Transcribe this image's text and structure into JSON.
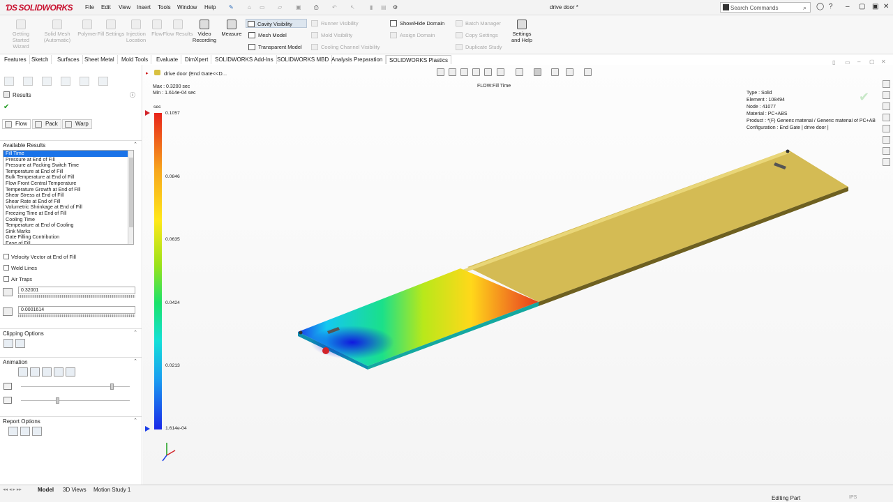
{
  "app": {
    "brand": "SOLIDWORKS",
    "document_title": "drive door *"
  },
  "menu": [
    "File",
    "Edit",
    "View",
    "Insert",
    "Tools",
    "Window",
    "Help"
  ],
  "search": {
    "placeholder": "Search Commands"
  },
  "ribbon": {
    "big_buttons": [
      {
        "label": "Getting Started Wizard",
        "enabled": false
      },
      {
        "label": "Solid Mesh (Automatic)",
        "enabled": false
      },
      {
        "label": "Polymer",
        "enabled": false
      },
      {
        "label": "Fill Settings",
        "enabled": false
      },
      {
        "label": "Injection Location",
        "enabled": false
      },
      {
        "label": "Flow",
        "enabled": false
      },
      {
        "label": "Flow Results",
        "enabled": false
      },
      {
        "label": "Video Recording",
        "enabled": true
      },
      {
        "label": "Measure",
        "enabled": true
      }
    ],
    "col1": [
      "Cavity Visibility",
      "Mesh Model",
      "Transparent Model"
    ],
    "col2": [
      "Runner Visibility",
      "Mold Visibility",
      "Cooling Channel Visibility"
    ],
    "col3": [
      "Show/Hide Domain",
      "Assign Domain"
    ],
    "col4": [
      "Batch Manager",
      "Copy Settings",
      "Duplicate Study"
    ],
    "settings": "Settings and Help"
  },
  "tabs": [
    "Features",
    "Sketch",
    "Surfaces",
    "Sheet Metal",
    "Mold Tools",
    "Evaluate",
    "DimXpert",
    "SOLIDWORKS Add-Ins",
    "SOLIDWORKS MBD",
    "Analysis Preparation",
    "SOLIDWORKS Plastics"
  ],
  "panel": {
    "title": "Results",
    "flow_tabs": [
      "Flow",
      "Pack",
      "Warp"
    ],
    "available_results_title": "Available Results",
    "results": [
      "Fill Time",
      "Pressure at End of Fill",
      "Pressure at Packing Switch Time",
      "Temperature at End of Fill",
      "Bulk Temperature at End of Fill",
      "Flow Front Central Temperature",
      "Temperature Growth at End of Fill",
      "Shear Stress at End of Fill",
      "Shear Rate at End of Fill",
      "Volumetric Shrinkage at End of Fill",
      "Freezing Time at End of Fill",
      "Cooling Time",
      "Temperature at End of Cooling",
      "Sink Marks",
      "Gate Filling Contribution",
      "Ease of Fill"
    ],
    "checkboxes": [
      "Velocity Vector at End of Fill",
      "Weld Lines",
      "Air Traps"
    ],
    "max_value": "0.32001",
    "min_value": "0.0001614",
    "clipping_title": "Clipping Options",
    "animation_title": "Animation",
    "report_title": "Report Options"
  },
  "viewport": {
    "tree_item": "drive door (End Gate<<D...",
    "max_label": "Max : 0.3200 sec",
    "min_label": "Min : 1.614e-04 sec",
    "plot_title": "FLOW:Fill Time",
    "info": [
      "Type : Solid",
      "Element : 108494",
      "Node : 41077",
      "Material : PC+ABS",
      "Product :  *(F)  Generic material / Generic material of PC+AB",
      "Configuration : End Gate | drive door |"
    ],
    "scale_unit": "sec",
    "scale_ticks": [
      "0.1057",
      "0.0846",
      "0.0635",
      "0.0424",
      "0.0213",
      "1.614e-04"
    ]
  },
  "bottom_tabs": [
    "Model",
    "3D Views",
    "Motion Study 1"
  ],
  "status": {
    "editing": "Editing Part",
    "units": "IPS"
  }
}
